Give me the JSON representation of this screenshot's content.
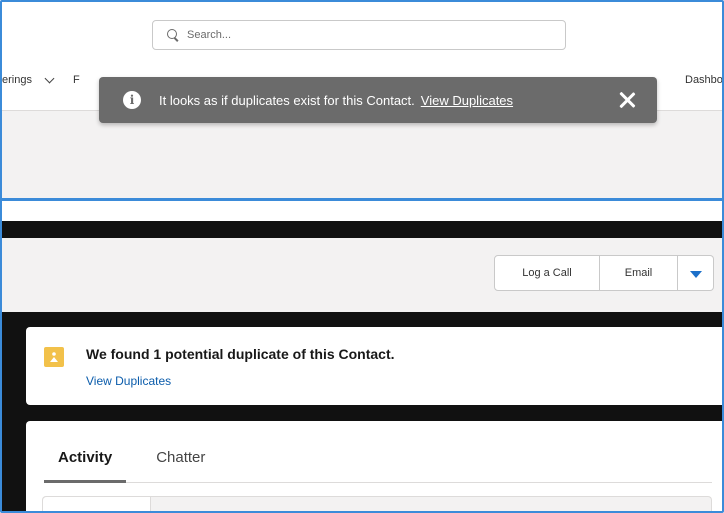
{
  "search": {
    "placeholder": "Search..."
  },
  "nav": {
    "left_fragment": "erings",
    "left_fragment2": "F",
    "right_fragment": "Dashboar"
  },
  "toast": {
    "message": "It looks as if duplicates exist for this Contact.",
    "link": "View Duplicates"
  },
  "actions": {
    "log_call": "Log a Call",
    "email": "Email"
  },
  "duplicate": {
    "title": "We found 1 potential duplicate of this Contact.",
    "link": "View Duplicates"
  },
  "tabs": [
    {
      "label": "Activity"
    },
    {
      "label": "Chatter"
    }
  ],
  "colors": {
    "accent": "#3b8bd9",
    "toast_bg": "#6b6b6b",
    "warning": "#f2c14a",
    "link": "#0b5cab"
  }
}
